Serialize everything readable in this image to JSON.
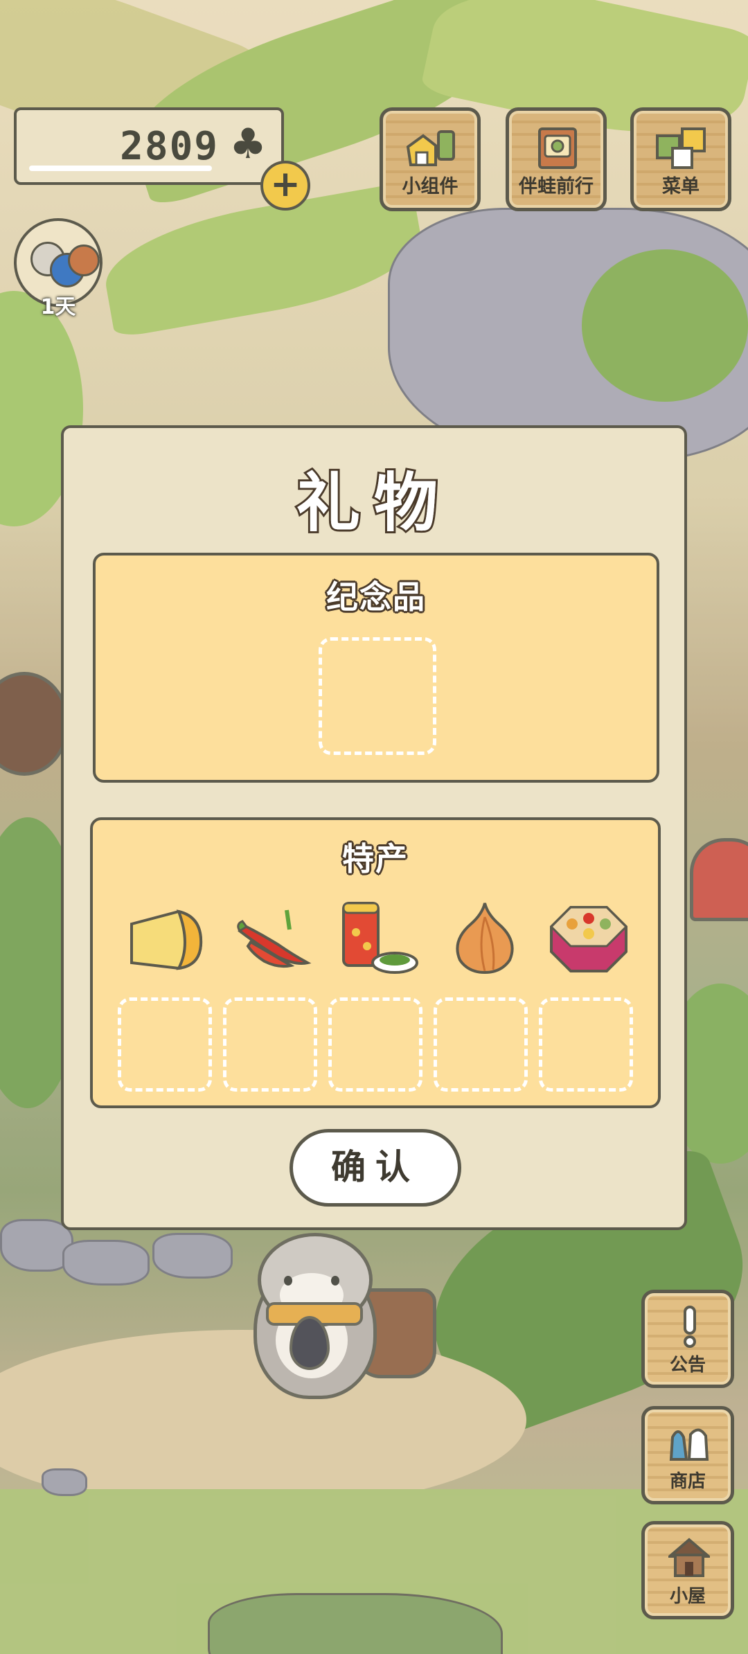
{
  "hud": {
    "clover_count": "2809",
    "clover_icon": "clover-icon",
    "visitor_days": "1天"
  },
  "top_menu": [
    {
      "label": "小组件",
      "icon": "widget-icon"
    },
    {
      "label": "伴蛙前行",
      "icon": "journey-book-icon"
    },
    {
      "label": "菜单",
      "icon": "menu-cards-icon"
    }
  ],
  "side_menu": [
    {
      "label": "公告",
      "icon": "exclamation-icon"
    },
    {
      "label": "商店",
      "icon": "shop-bags-icon"
    },
    {
      "label": "小屋",
      "icon": "house-icon"
    }
  ],
  "dialog": {
    "title": "礼物",
    "souvenir": {
      "title": "纪念品",
      "slots": 1
    },
    "specialty": {
      "title": "特产",
      "items": [
        {
          "icon": "cheese-icon"
        },
        {
          "icon": "chili-pepper-icon"
        },
        {
          "icon": "tea-can-icon"
        },
        {
          "icon": "onion-icon"
        },
        {
          "icon": "bento-box-icon"
        }
      ],
      "slots": 5
    },
    "confirm_label": "确认"
  },
  "colors": {
    "panel_bg": "#ece3c8",
    "section_bg": "#fddf9c",
    "outline": "#5c5a4c",
    "accent_yellow": "#f2c94c"
  }
}
